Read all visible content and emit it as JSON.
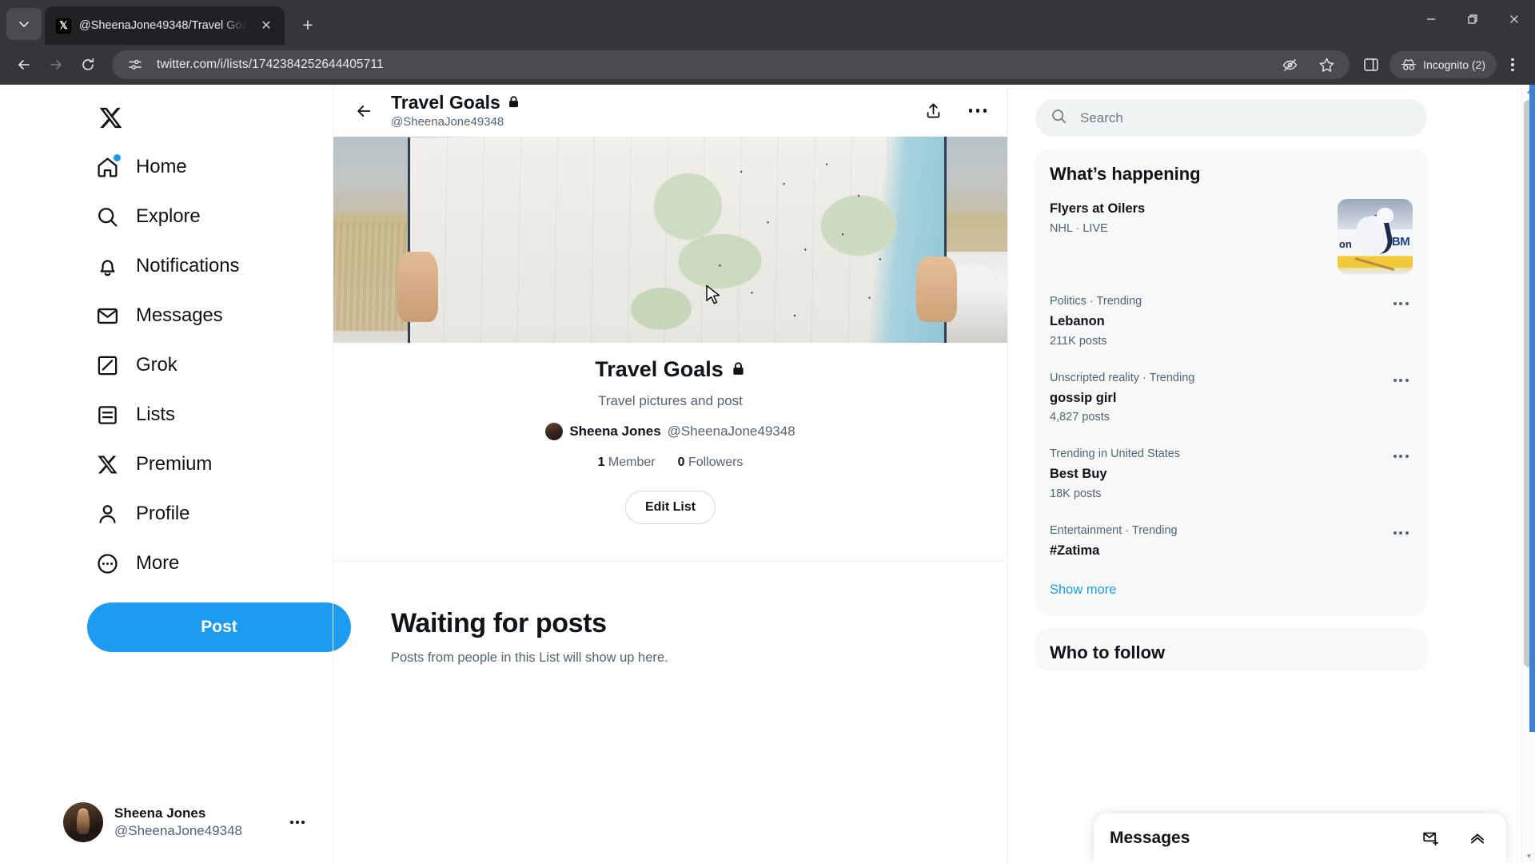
{
  "browser": {
    "tab": {
      "title": "@SheenaJone49348/Travel Goa",
      "favicon": "x-logo-icon",
      "close_icon": "✕"
    },
    "tab_search_icon": "chevron-down-icon",
    "new_tab_icon": "+",
    "window": {
      "minimize": "–",
      "maximize": "❐",
      "close": "✕"
    },
    "nav": {
      "back": "←",
      "forward": "→",
      "reload": "⟳"
    },
    "omnibox": {
      "url": "twitter.com/i/lists/1742384252644405711",
      "site_info_icon": "tune-icon"
    },
    "toolbar": {
      "tracking_protection_icon": "eye-slash-icon",
      "bookmark_icon": "star-icon",
      "side_panel_icon": "side-panel-icon",
      "incognito_label": "Incognito (2)",
      "incognito_icon": "incognito-hat-icon",
      "menu_icon": "three-dots-vertical-icon"
    }
  },
  "sidebar": {
    "logo": "x-logo-icon",
    "items": [
      {
        "label": "Home",
        "icon": "home-icon",
        "badge": true
      },
      {
        "label": "Explore",
        "icon": "search-icon",
        "badge": false
      },
      {
        "label": "Notifications",
        "icon": "bell-icon",
        "badge": false
      },
      {
        "label": "Messages",
        "icon": "envelope-icon",
        "badge": false
      },
      {
        "label": "Grok",
        "icon": "grok-icon",
        "badge": false
      },
      {
        "label": "Lists",
        "icon": "list-icon",
        "badge": false
      },
      {
        "label": "Premium",
        "icon": "x-logo-icon",
        "badge": false
      },
      {
        "label": "Profile",
        "icon": "person-icon",
        "badge": false
      },
      {
        "label": "More",
        "icon": "more-circle-icon",
        "badge": false
      }
    ],
    "post_button": "Post",
    "account": {
      "name": "Sheena Jones",
      "handle": "@SheenaJone49348",
      "avatar": "user-avatar",
      "menu_icon": "three-dots-icon"
    }
  },
  "main": {
    "header": {
      "back_icon": "arrow-left-icon",
      "title": "Travel Goals",
      "lock_icon": "lock-icon",
      "subtitle": "@SheenaJone49348",
      "share_icon": "share-upload-icon",
      "more_icon": "three-dots-icon"
    },
    "banner": {
      "alt": "person holding folded road map in desert"
    },
    "list": {
      "title": "Travel Goals",
      "lock_icon": "lock-icon",
      "description": "Travel pictures and post",
      "owner_name": "Sheena Jones",
      "owner_handle": "@SheenaJone49348",
      "members_count": "1",
      "members_label": "Member",
      "followers_count": "0",
      "followers_label": "Followers",
      "edit_button": "Edit List"
    },
    "empty": {
      "title": "Waiting for posts",
      "subtitle": "Posts from people in this List will show up here."
    }
  },
  "right": {
    "search": {
      "placeholder": "Search",
      "icon": "search-icon"
    },
    "whats_happening": {
      "title": "What’s happening",
      "news": {
        "headline": "Flyers at Oilers",
        "meta": "NHL · LIVE",
        "thumb_alt": "hockey player"
      },
      "trends": [
        {
          "category": "Politics · Trending",
          "name": "Lebanon",
          "posts": "211K posts",
          "menu_icon": "three-dots-icon"
        },
        {
          "category": "Unscripted reality · Trending",
          "name": "gossip girl",
          "posts": "4,827 posts",
          "menu_icon": "three-dots-icon"
        },
        {
          "category": "Trending in United States",
          "name": "Best Buy",
          "posts": "18K posts",
          "menu_icon": "three-dots-icon"
        },
        {
          "category": "Entertainment · Trending",
          "name": "#Zatima",
          "posts": "",
          "menu_icon": "three-dots-icon"
        }
      ],
      "show_more": "Show more"
    },
    "who_to_follow": {
      "title": "Who to follow"
    }
  },
  "messages_dock": {
    "title": "Messages",
    "new_message_icon": "new-message-icon",
    "expand_icon": "chevron-up-icon"
  },
  "colors": {
    "accent": "#1d9bf0",
    "text_primary": "#0f1419",
    "text_secondary": "#536471",
    "chrome_bg": "#35363a",
    "card_bg": "#f7f9f9"
  }
}
